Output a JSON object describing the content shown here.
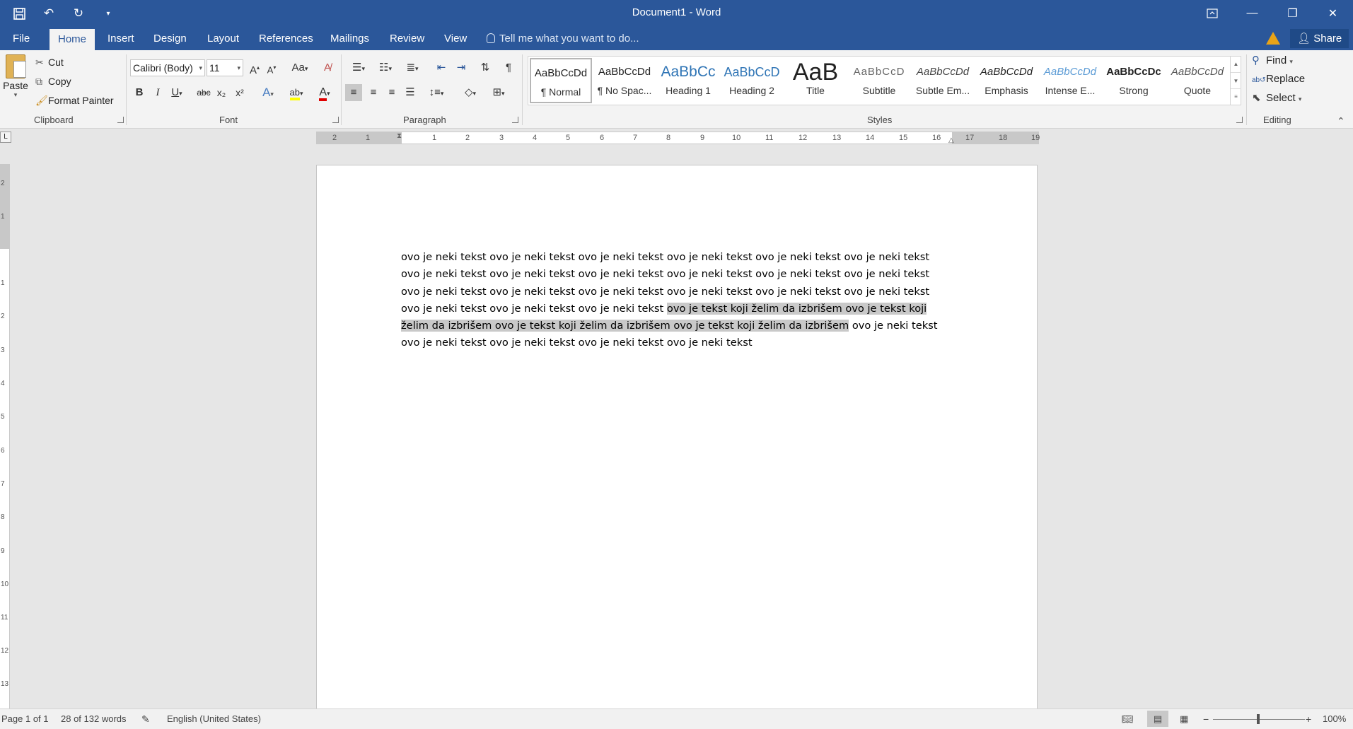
{
  "window": {
    "title": "Document1 - Word"
  },
  "tabs": [
    "File",
    "Home",
    "Insert",
    "Design",
    "Layout",
    "References",
    "Mailings",
    "Review",
    "View"
  ],
  "tell_me": "Tell me what you want to do...",
  "share": "Share",
  "clipboard": {
    "paste": "Paste",
    "cut": "Cut",
    "copy": "Copy",
    "format_painter": "Format Painter",
    "label": "Clipboard"
  },
  "font": {
    "name": "Calibri (Body)",
    "size": "11",
    "label": "Font",
    "case": "Aa",
    "bold": "B",
    "italic": "I",
    "underline": "U",
    "strike": "abc",
    "sub": "x₂",
    "sup": "x²",
    "effects": "A",
    "highlight": "ab",
    "color": "A"
  },
  "paragraph": {
    "label": "Paragraph",
    "pilcrow": "¶"
  },
  "styles": {
    "label": "Styles",
    "items": [
      {
        "preview": "AaBbCcDd",
        "name": "¶ Normal"
      },
      {
        "preview": "AaBbCcDd",
        "name": "¶ No Spac..."
      },
      {
        "preview": "AaBbCc",
        "name": "Heading 1"
      },
      {
        "preview": "AaBbCcD",
        "name": "Heading 2"
      },
      {
        "preview": "AaB",
        "name": "Title"
      },
      {
        "preview": "AaBbCcD",
        "name": "Subtitle"
      },
      {
        "preview": "AaBbCcDd",
        "name": "Subtle Em..."
      },
      {
        "preview": "AaBbCcDd",
        "name": "Emphasis"
      },
      {
        "preview": "AaBbCcDd",
        "name": "Intense E..."
      },
      {
        "preview": "AaBbCcDc",
        "name": "Strong"
      },
      {
        "preview": "AaBbCcDd",
        "name": "Quote"
      }
    ]
  },
  "editing": {
    "find": "Find",
    "replace": "Replace",
    "select": "Select",
    "label": "Editing"
  },
  "ruler": {
    "h_ticks": [
      "2",
      "1",
      "1",
      "2",
      "3",
      "4",
      "5",
      "6",
      "7",
      "8",
      "9",
      "10",
      "11",
      "12",
      "13",
      "14",
      "15",
      "16",
      "17",
      "18",
      "19"
    ],
    "v_ticks": [
      "2",
      "1",
      "1",
      "2",
      "3",
      "4",
      "5",
      "6",
      "7",
      "8",
      "9",
      "10",
      "11",
      "12",
      "13"
    ]
  },
  "document": {
    "text_before": "ovo je neki tekst ovo je neki tekst ovo je neki tekst ovo je neki tekst ovo je neki tekst ovo je neki tekst ovo je neki tekst ovo je neki tekst ovo je neki tekst ovo je neki tekst ovo je neki tekst ovo je neki tekst ovo je neki tekst ovo je neki tekst ovo je neki tekst ovo je neki tekst ovo je neki tekst ovo je neki tekst ovo je neki tekst ovo je neki tekst ovo je neki tekst ",
    "text_selected": "ovo je tekst koji želim da izbrišem ovo je tekst koji želim da izbrišem ovo je tekst koji želim da izbrišem ovo je tekst koji želim da izbrišem",
    "text_after": " ovo je neki tekst ovo je neki tekst ovo je neki tekst ovo je neki tekst ovo je neki tekst"
  },
  "status": {
    "page": "Page 1 of 1",
    "words": "28 of 132 words",
    "language": "English (United States)",
    "zoom": "100%"
  },
  "colors": {
    "accent": "#2b579a",
    "selection": "#c9c9c9"
  }
}
